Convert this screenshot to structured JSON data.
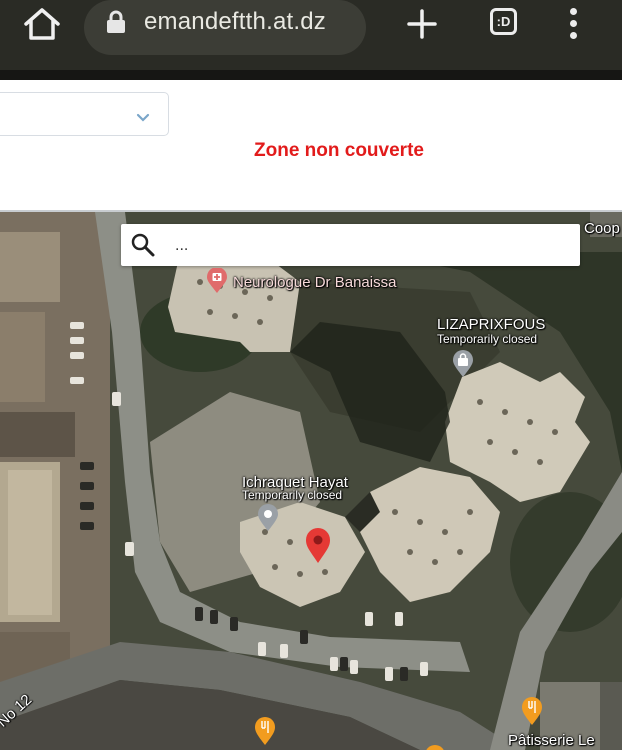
{
  "browser": {
    "url": "emandeftth.at.dz",
    "tab_count_label": ":D"
  },
  "form": {
    "select_value": "",
    "zone_status": "Zone non couverte",
    "status_color": "#e21b1b"
  },
  "map": {
    "search_placeholder": "...",
    "places": [
      {
        "name": "Neurologue Dr Banaissa",
        "status": ""
      },
      {
        "name": "LIZAPRIXFOUS",
        "status": "Temporarily closed"
      },
      {
        "name": "Ichraquet Hayat",
        "status": "Temporarily closed"
      },
      {
        "name": "Pâtisserie Le",
        "status": ""
      },
      {
        "name": "Coop",
        "status": ""
      }
    ],
    "road_label": "No 12",
    "marker_color": "#e53935"
  }
}
